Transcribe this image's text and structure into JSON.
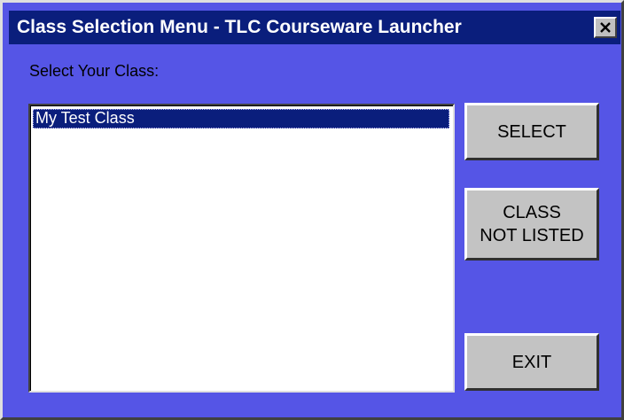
{
  "window": {
    "title": "Class Selection Menu - TLC Courseware Launcher",
    "close_icon": "close-x-icon"
  },
  "main": {
    "prompt": "Select Your Class:",
    "classes": [
      {
        "label": "My Test Class",
        "selected": true
      }
    ]
  },
  "buttons": {
    "select": "SELECT",
    "class_not_listed_line1": "CLASS",
    "class_not_listed_line2": "NOT LISTED",
    "exit": "EXIT"
  },
  "colors": {
    "window_background": "#5555e6",
    "titlebar": "#0a1e7c",
    "button_face": "#c3c3c3",
    "selection": "#0a1e7c"
  }
}
